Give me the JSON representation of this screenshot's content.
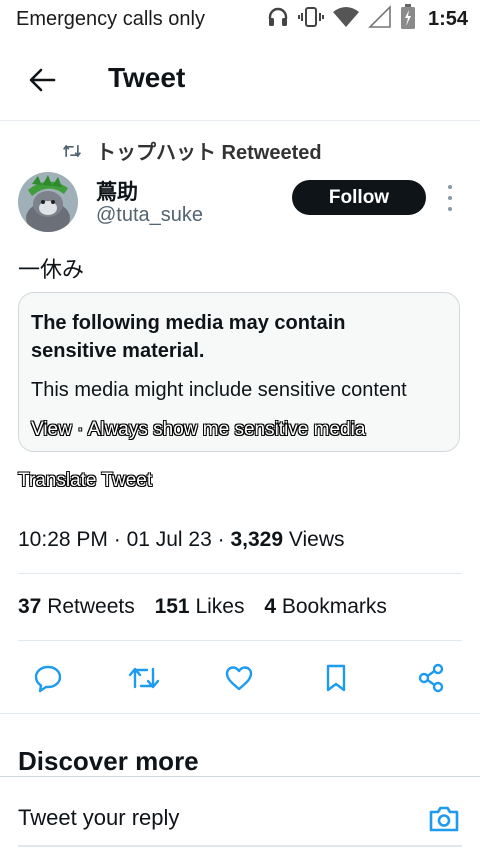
{
  "status_bar": {
    "carrier": "Emergency calls only",
    "time": "1:54",
    "icons": [
      "headset-icon",
      "vibrate-icon",
      "wifi-icon",
      "signal-icon",
      "battery-charging-icon"
    ]
  },
  "header": {
    "title": "Tweet",
    "back_icon": "arrow-left-icon"
  },
  "tweet": {
    "retweeted_by": "トップハット Retweeted",
    "author_name": "蔦助",
    "author_handle": "@tuta_suke",
    "follow_label": "Follow",
    "text": "一休み",
    "sensitive": {
      "title": "The following media may contain sensitive material.",
      "body": "This media might include sensitive content",
      "view_label": "View",
      "separator": " · ",
      "always_show_label": "Always show me sensitive media"
    },
    "translate_label": "Translate Tweet",
    "time": "10:28 PM",
    "date": "01 Jul 23",
    "dot": " · ",
    "views_count": "3,329",
    "views_label": " Views",
    "stats": {
      "retweets_count": "37",
      "retweets_label": " Retweets",
      "likes_count": "151",
      "likes_label": " Likes",
      "bookmarks_count": "4",
      "bookmarks_label": " Bookmarks"
    }
  },
  "discover": {
    "title": "Discover more"
  },
  "reply": {
    "placeholder": "Tweet your reply"
  },
  "colors": {
    "accent": "#1d9bf0",
    "text": "#0f1419",
    "muted": "#536471",
    "follow_bg": "#0f1419"
  }
}
